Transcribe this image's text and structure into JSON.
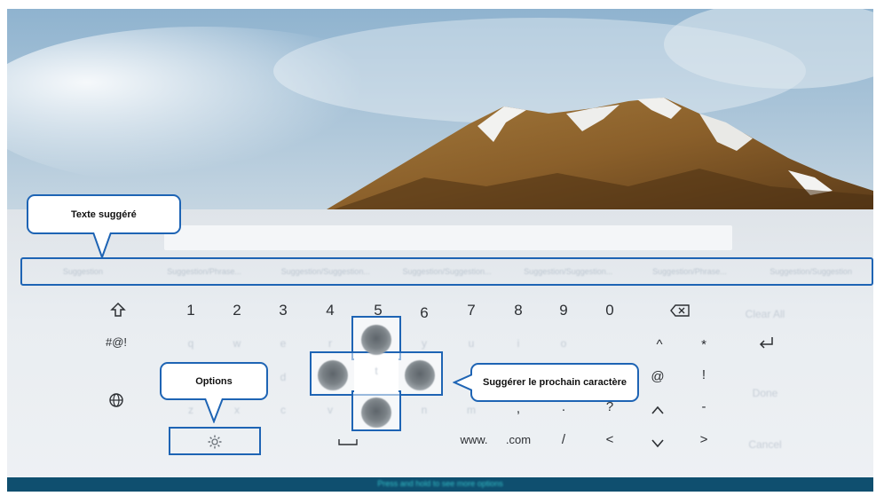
{
  "callouts": {
    "suggested_text": "Texte suggéré",
    "options": "Options",
    "predict_next": "Suggérer le prochain caractère"
  },
  "suggestions": [
    "Suggestion",
    "Suggestion/Phrase...",
    "Suggestion/Suggestion...",
    "Suggestion/Suggestion...",
    "Suggestion/Suggestion...",
    "Suggestion/Phrase...",
    "Suggestion/Suggestion"
  ],
  "keyboard": {
    "row1": [
      "1",
      "2",
      "3",
      "4",
      "5",
      "6",
      "7",
      "8",
      "9",
      "0"
    ],
    "row2_faint": [
      "q",
      "w",
      "e",
      "r",
      "t",
      "y",
      "u",
      "i",
      "o",
      "p"
    ],
    "row3_faint": [
      "a",
      "s",
      "d",
      "f",
      "g",
      "h",
      "j",
      "k",
      "l"
    ],
    "row4_faint": [
      "z",
      "x",
      "c",
      "v",
      "b",
      "n",
      "m"
    ],
    "symbols_key": "#@!",
    "www_key": "www.",
    "com_key": ".com",
    "caret": "^",
    "asterisk": "*",
    "at": "@",
    "exclaim": "!",
    "comma": ",",
    "period": ".",
    "question": "?",
    "minus": "-",
    "slash": "/",
    "lt": "<",
    "gt": ">",
    "faint_right_labels": [
      "Clear All",
      "Done",
      "Cancel"
    ],
    "center_key": "t"
  },
  "bottom_hint": "Press and hold to see more options",
  "colors": {
    "accent": "#1e64b4",
    "panel": "#e6eaee",
    "bottom_bar": "#0f4f6f"
  }
}
